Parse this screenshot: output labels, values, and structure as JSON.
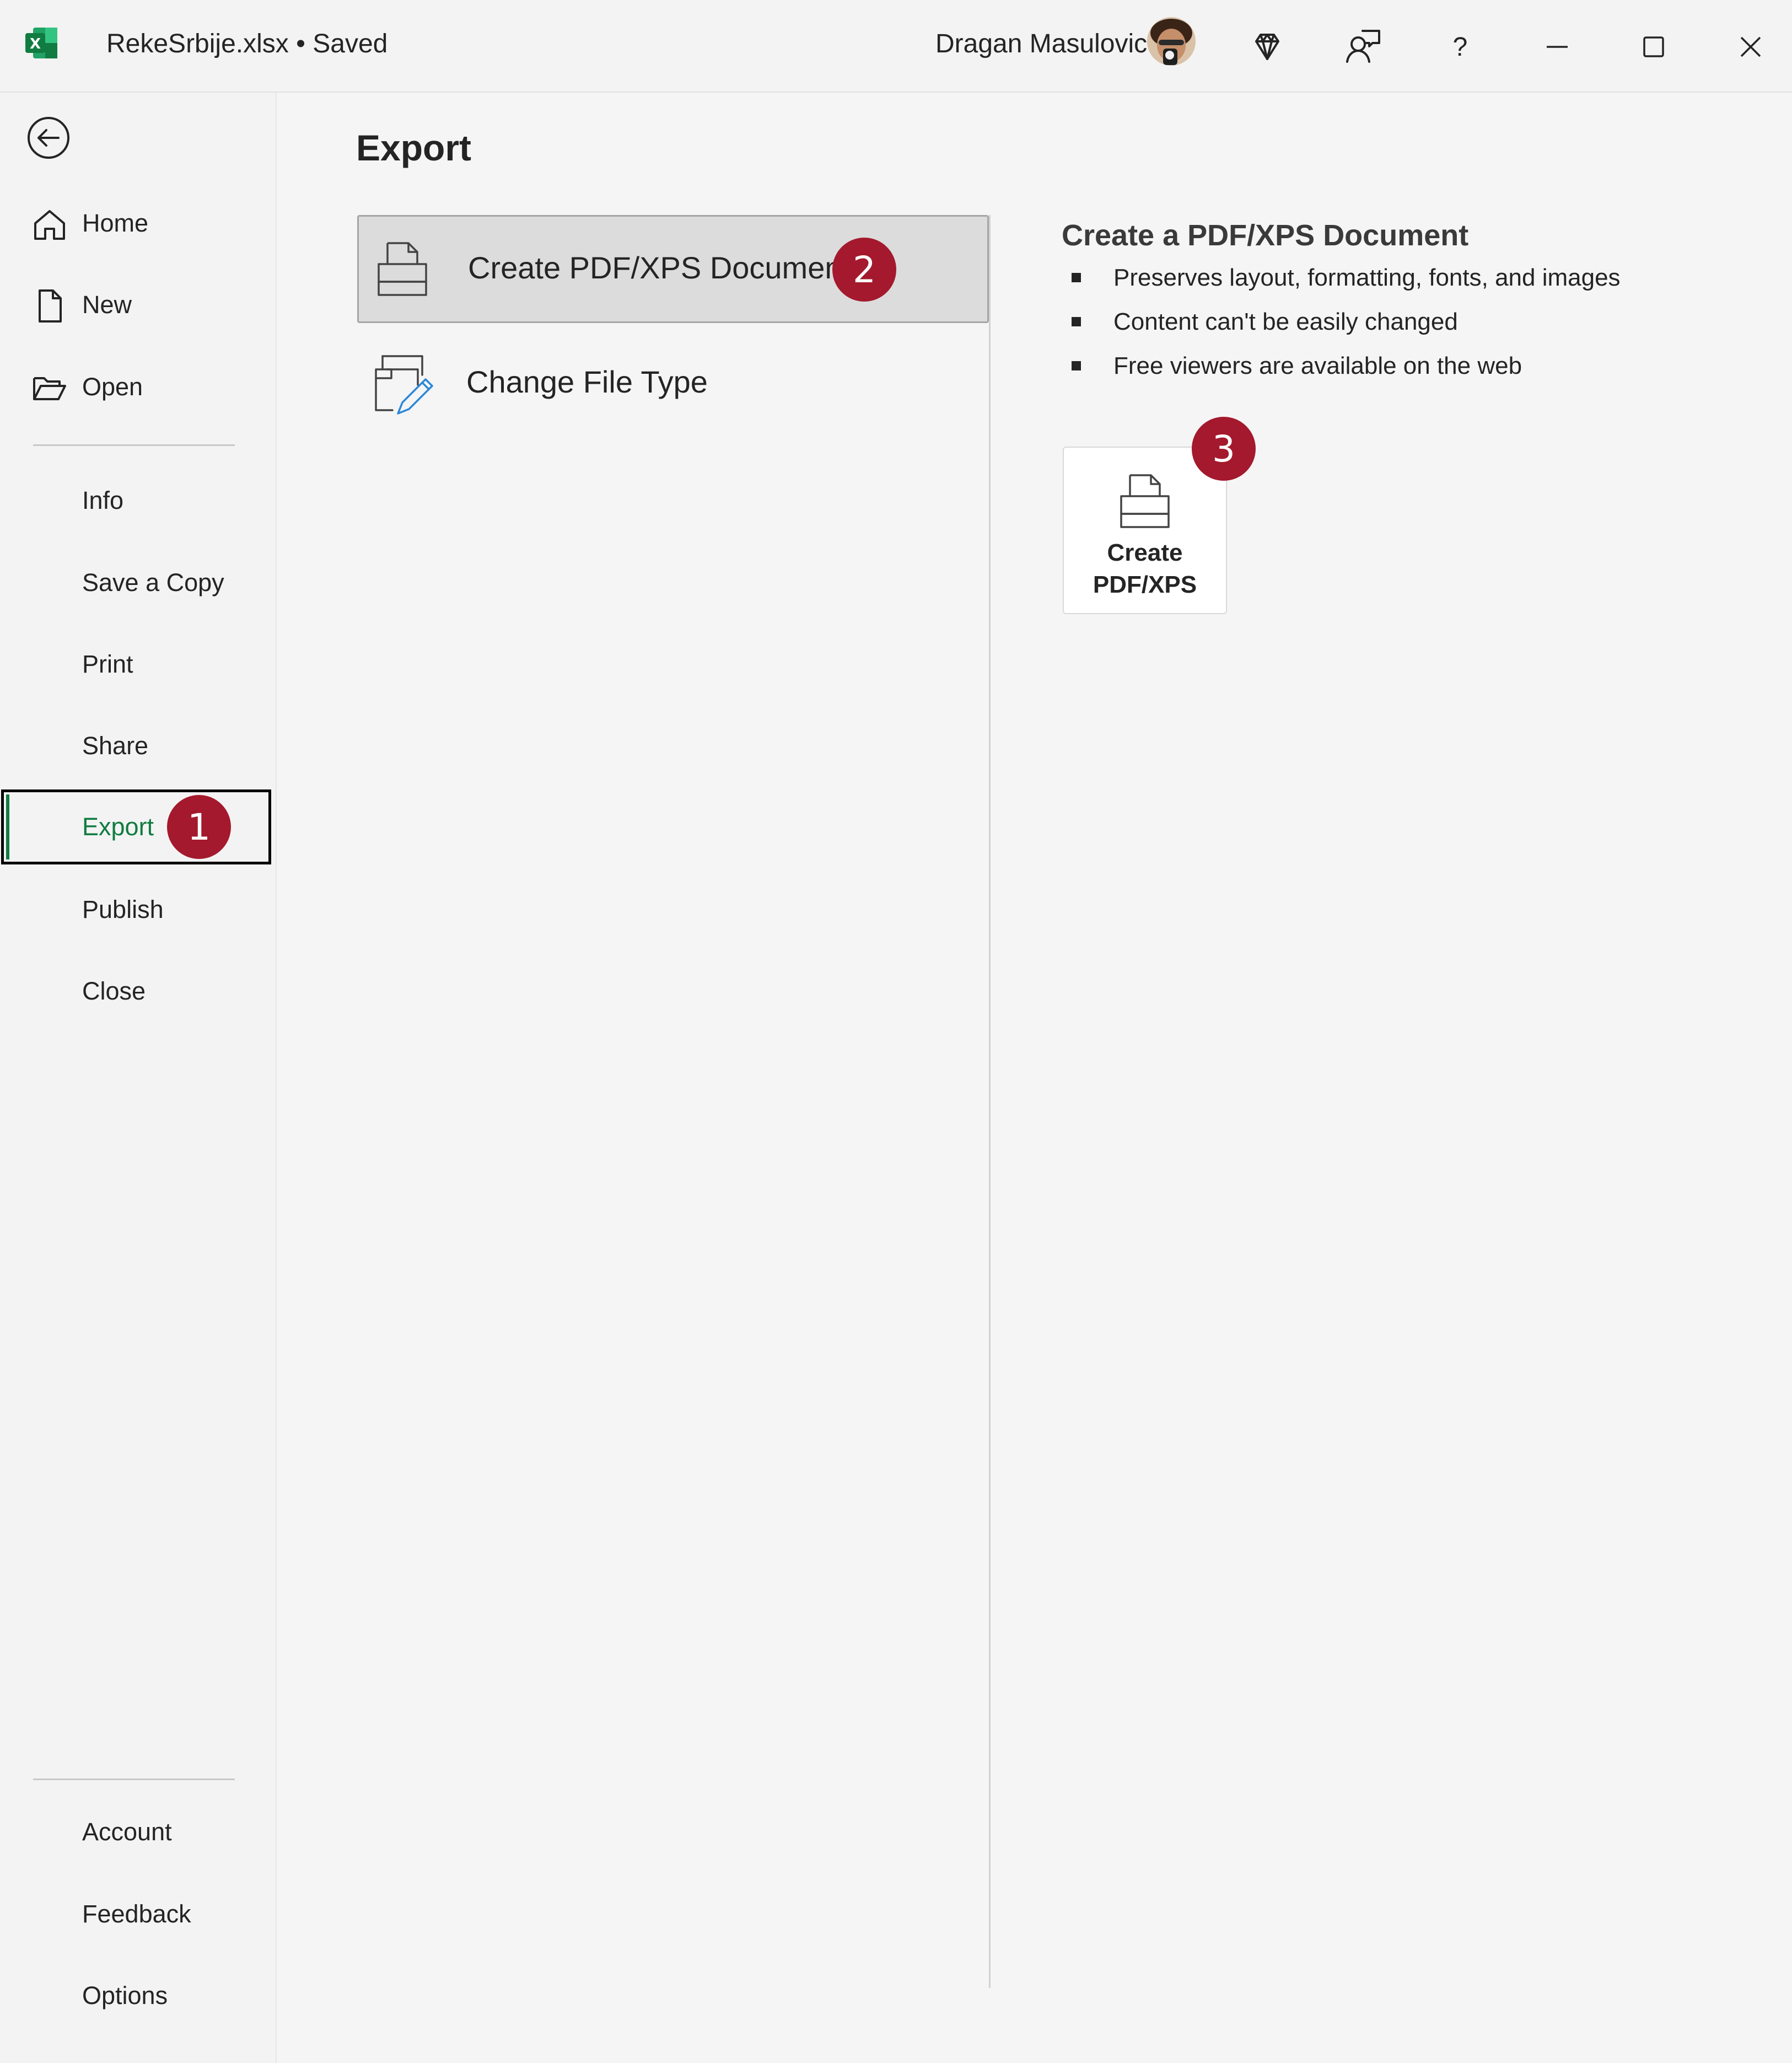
{
  "titlebar": {
    "app_icon": "excel-icon",
    "title": "RekeSrbije.xlsx • Saved",
    "user_name": "Dragan Masulovic",
    "buttons": [
      "premium-diamond-icon",
      "coauthor-icon",
      "help-icon",
      "minimize-icon",
      "maximize-icon",
      "close-icon"
    ],
    "help_label": "?"
  },
  "sidebar": {
    "back_icon": "back-arrow-icon",
    "top_items": [
      {
        "label": "Home",
        "icon": "home-icon"
      },
      {
        "label": "New",
        "icon": "new-document-icon"
      },
      {
        "label": "Open",
        "icon": "open-folder-icon"
      }
    ],
    "middle_items": [
      {
        "label": "Info"
      },
      {
        "label": "Save a Copy"
      },
      {
        "label": "Print"
      },
      {
        "label": "Share"
      },
      {
        "label": "Export",
        "selected": true,
        "badge": "1"
      },
      {
        "label": "Publish"
      },
      {
        "label": "Close"
      }
    ],
    "bottom_items": [
      {
        "label": "Account"
      },
      {
        "label": "Feedback"
      },
      {
        "label": "Options"
      }
    ],
    "accent_color": "#107c41"
  },
  "main": {
    "heading": "Export",
    "options": [
      {
        "label": "Create PDF/XPS Document",
        "icon": "pdf-document-icon",
        "selected": true,
        "badge": "2"
      },
      {
        "label": "Change File Type",
        "icon": "change-file-type-icon"
      }
    ],
    "detail": {
      "title": "Create a PDF/XPS Document",
      "bullets": [
        "Preserves layout, formatting, fonts, and images",
        "Content can't be easily changed",
        "Free viewers are available on the web"
      ],
      "button_line1": "Create",
      "button_line2": "PDF/XPS",
      "button_icon": "pdf-document-icon",
      "badge": "3"
    },
    "badge_color": "#a4192d"
  }
}
